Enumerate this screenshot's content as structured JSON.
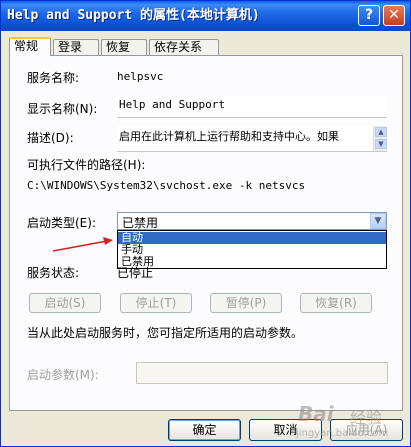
{
  "window": {
    "title": "Help and Support 的属性(本地计算机)",
    "help_btn": "?",
    "close_btn": "✕"
  },
  "tabs": [
    {
      "label": "常规",
      "active": true
    },
    {
      "label": "登录",
      "active": false
    },
    {
      "label": "恢复",
      "active": false
    },
    {
      "label": "依存关系",
      "active": false
    }
  ],
  "general": {
    "service_name_label": "服务名称:",
    "service_name_value": "helpsvc",
    "display_name_label": "显示名称(N):",
    "display_name_value": "Help and Support",
    "description_label": "描述(D):",
    "description_value": "启用在此计算机上运行帮助和支持中心。如果",
    "exec_path_label": "可执行文件的路径(H):",
    "exec_path_value": "C:\\WINDOWS\\System32\\svchost.exe -k netsvcs",
    "startup_type_label": "启动类型(E):",
    "startup_type_value": "已禁用",
    "startup_options": [
      "自动",
      "手动",
      "已禁用"
    ],
    "startup_selected": "自动",
    "service_status_label": "服务状态:",
    "service_status_value": "已停止",
    "buttons": {
      "start": "启动(S)",
      "stop": "停止(T)",
      "pause": "暂停(P)",
      "resume": "恢复(R)"
    },
    "hint": "当从此处启动服务时，您可指定所适用的启动参数。",
    "params_label": "启动参数(M):",
    "params_value": ""
  },
  "footer": {
    "ok": "确定",
    "cancel": "取消",
    "apply": "应用(A)"
  },
  "watermark": {
    "brand": "Bai",
    "brand2": "经验",
    "url": "jingyan.baidu.com"
  },
  "colors": {
    "titlebar": "#0a5fe8",
    "selection": "#316ac5",
    "arrow": "#d42020"
  }
}
